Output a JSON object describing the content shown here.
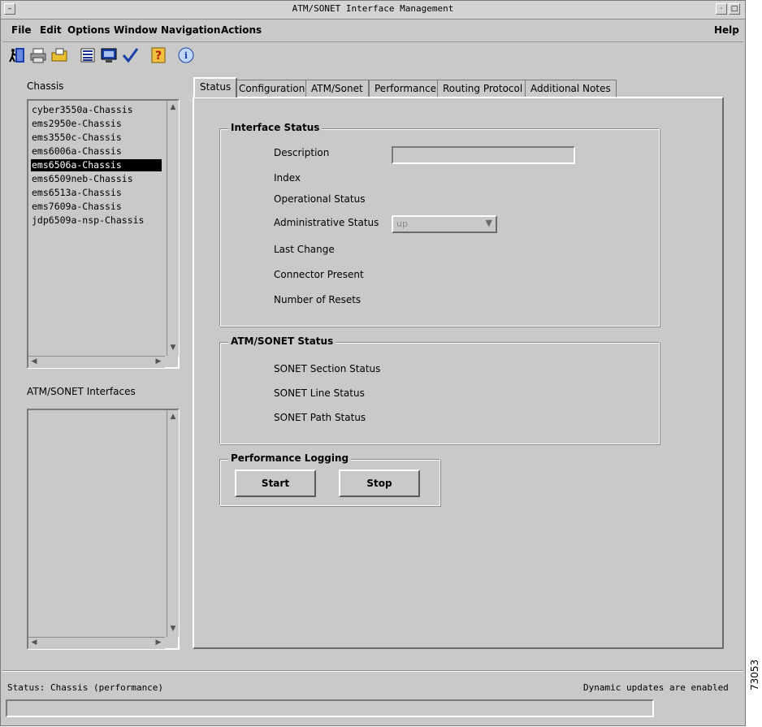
{
  "window": {
    "title": "ATM/SONET Interface Management"
  },
  "menu": {
    "items": [
      {
        "label": "File"
      },
      {
        "label": "Edit"
      },
      {
        "label": "Options"
      },
      {
        "label": "Window"
      },
      {
        "label": "Navigation"
      },
      {
        "label": "Actions"
      }
    ],
    "help": "Help"
  },
  "toolbar": {
    "icons": [
      "exit-icon",
      "print-icon",
      "open-folder-icon",
      "list-icon",
      "monitor-icon",
      "checkmark-icon",
      "help-icon",
      "info-icon"
    ]
  },
  "chassis": {
    "label": "Chassis",
    "items": [
      "cyber3550a-Chassis",
      "ems2950e-Chassis",
      "ems3550c-Chassis",
      "ems6006a-Chassis",
      "ems6506a-Chassis",
      "ems6509neb-Chassis",
      "ems6513a-Chassis",
      "ems7609a-Chassis",
      "jdp6509a-nsp-Chassis"
    ],
    "selected": "ems6506a-Chassis"
  },
  "interfaces": {
    "label": "ATM/SONET Interfaces",
    "items": []
  },
  "tabs": [
    {
      "label": "Status",
      "active": true
    },
    {
      "label": "Configuration"
    },
    {
      "label": "ATM/Sonet"
    },
    {
      "label": "Performance"
    },
    {
      "label": "Routing Protocol"
    },
    {
      "label": "Additional Notes"
    }
  ],
  "interface_status": {
    "title": "Interface Status",
    "description_label": "Description",
    "description_value": "",
    "index_label": "Index",
    "operational_label": "Operational Status",
    "administrative_label": "Administrative Status",
    "administrative_value": "up",
    "last_change_label": "Last Change",
    "connector_label": "Connector Present",
    "resets_label": "Number of Resets"
  },
  "atm_sonet_status": {
    "title": "ATM/SONET Status",
    "section_label": "SONET Section Status",
    "line_label": "SONET Line Status",
    "path_label": "SONET Path Status"
  },
  "performance_logging": {
    "title": "Performance Logging",
    "start": "Start",
    "stop": "Stop"
  },
  "status_bar": {
    "left": "Status: Chassis (performance)",
    "right": "Dynamic updates are enabled"
  },
  "figure_number": "73053"
}
